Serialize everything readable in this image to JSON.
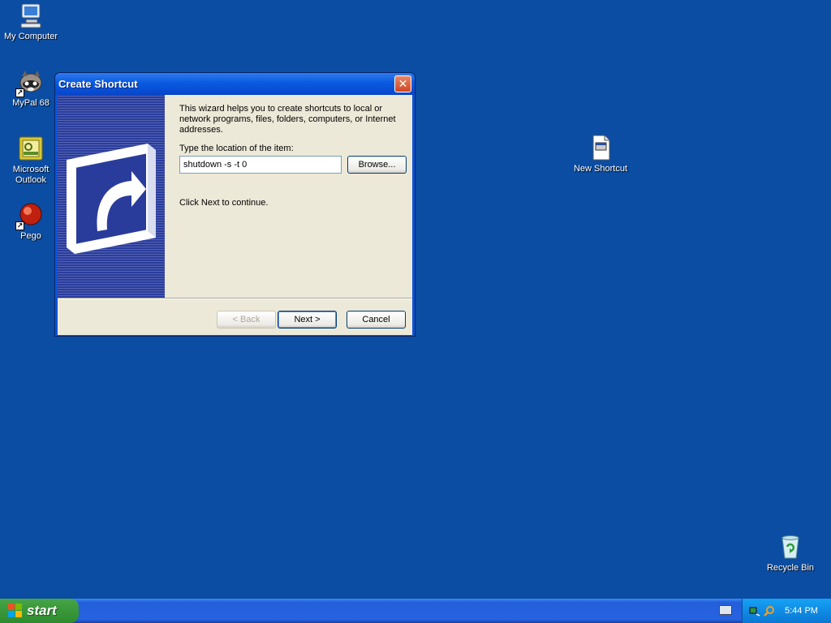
{
  "desktop": {
    "icons": [
      {
        "label": "My Computer"
      },
      {
        "label": "MyPal 68"
      },
      {
        "label": "Microsoft Outlook"
      },
      {
        "label": "Pego"
      },
      {
        "label": "New Shortcut"
      },
      {
        "label": "Recycle Bin"
      }
    ]
  },
  "dialog": {
    "title": "Create Shortcut",
    "close_symbol": "✕",
    "intro": "This wizard helps you to create shortcuts to local or network programs, files, folders, computers, or Internet addresses.",
    "location_label": "Type the location of the item:",
    "location_value": "shutdown -s -t 0",
    "browse_label": "Browse...",
    "hint": "Click Next to continue.",
    "back_label": "< Back",
    "next_label": "Next >",
    "cancel_label": "Cancel"
  },
  "taskbar": {
    "start_label": "start",
    "clock": "5:44 PM"
  },
  "colors": {
    "desktop": "#0B4DA2",
    "titlebar": "#0A5AE0",
    "dialog_face": "#ECE9D8",
    "start_green": "#3C9A3C"
  }
}
